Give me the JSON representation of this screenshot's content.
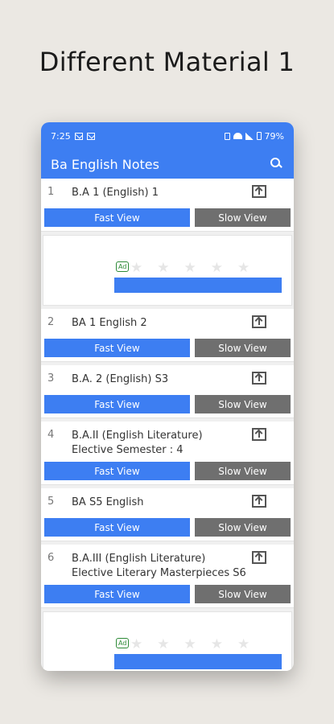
{
  "promo": {
    "title": "Different Material 1"
  },
  "status_bar": {
    "time": "7:25",
    "battery": "79%"
  },
  "app_bar": {
    "title": "Ba English Notes"
  },
  "buttons": {
    "fast_view": "Fast View",
    "slow_view": "Slow View"
  },
  "ad": {
    "badge": "Ad"
  },
  "items": [
    {
      "number": "1",
      "title": "B.A 1 (English) 1"
    },
    {
      "number": "2",
      "title": "BA 1 English 2"
    },
    {
      "number": "3",
      "title": "B.A. 2 (English) S3"
    },
    {
      "number": "4",
      "title": "B.A.II (English Literature) Elective Semester : 4"
    },
    {
      "number": "5",
      "title": "BA S5  English"
    },
    {
      "number": "6",
      "title": "B.A.III (English Literature) Elective Literary Masterpieces S6"
    }
  ],
  "colors": {
    "accent": "#3d7ef2",
    "slow_button": "#6f6f6f",
    "ad_badge": "#2d8a36"
  }
}
